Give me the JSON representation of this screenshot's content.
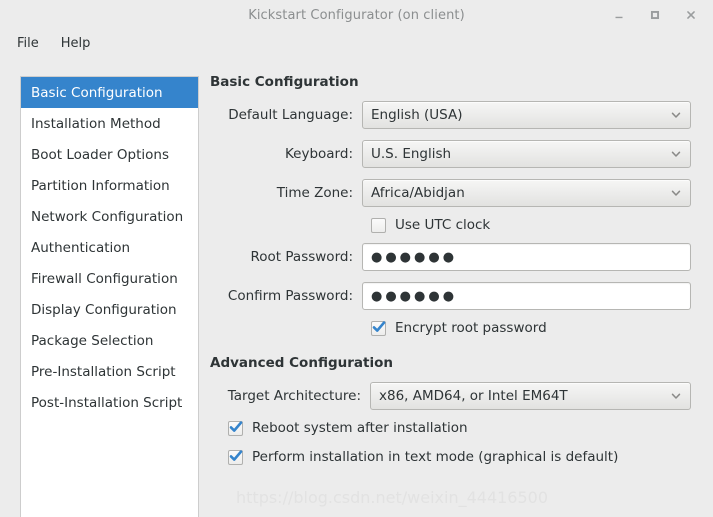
{
  "window": {
    "title": "Kickstart Configurator (on client)",
    "controls": [
      {
        "name": "minimize",
        "glyph": "_"
      },
      {
        "name": "maximize",
        "glyph": "□"
      },
      {
        "name": "close",
        "glyph": "×"
      }
    ]
  },
  "menubar": {
    "items": [
      {
        "label": "File"
      },
      {
        "label": "Help"
      }
    ]
  },
  "sidebar": {
    "items": [
      {
        "label": "Basic Configuration",
        "selected": true
      },
      {
        "label": "Installation Method",
        "selected": false
      },
      {
        "label": "Boot Loader Options",
        "selected": false
      },
      {
        "label": "Partition Information",
        "selected": false
      },
      {
        "label": "Network Configuration",
        "selected": false
      },
      {
        "label": "Authentication",
        "selected": false
      },
      {
        "label": "Firewall Configuration",
        "selected": false
      },
      {
        "label": "Display Configuration",
        "selected": false
      },
      {
        "label": "Package Selection",
        "selected": false
      },
      {
        "label": "Pre-Installation Script",
        "selected": false
      },
      {
        "label": "Post-Installation Script",
        "selected": false
      }
    ]
  },
  "basic": {
    "heading": "Basic Configuration",
    "language_label": "Default Language:",
    "language_value": "English (USA)",
    "keyboard_label": "Keyboard:",
    "keyboard_value": "U.S. English",
    "timezone_label": "Time Zone:",
    "timezone_value": "Africa/Abidjan",
    "utc_label": "Use UTC clock",
    "utc_checked": false,
    "root_password_label": "Root Password:",
    "root_password_value": "●●●●●●",
    "confirm_password_label": "Confirm Password:",
    "confirm_password_value": "●●●●●●",
    "encrypt_label": "Encrypt root password",
    "encrypt_checked": true
  },
  "advanced": {
    "heading": "Advanced Configuration",
    "arch_label": "Target Architecture:",
    "arch_value": "x86, AMD64, or Intel EM64T",
    "reboot_label": "Reboot system after installation",
    "reboot_checked": true,
    "textmode_label": "Perform installation in text mode (graphical is default)",
    "textmode_checked": true
  },
  "watermark": {
    "text": "https://blog.csdn.net/weixin_44416500"
  },
  "colors": {
    "selection": "#3584cc",
    "background": "#ececec",
    "check": "#3584cc"
  }
}
